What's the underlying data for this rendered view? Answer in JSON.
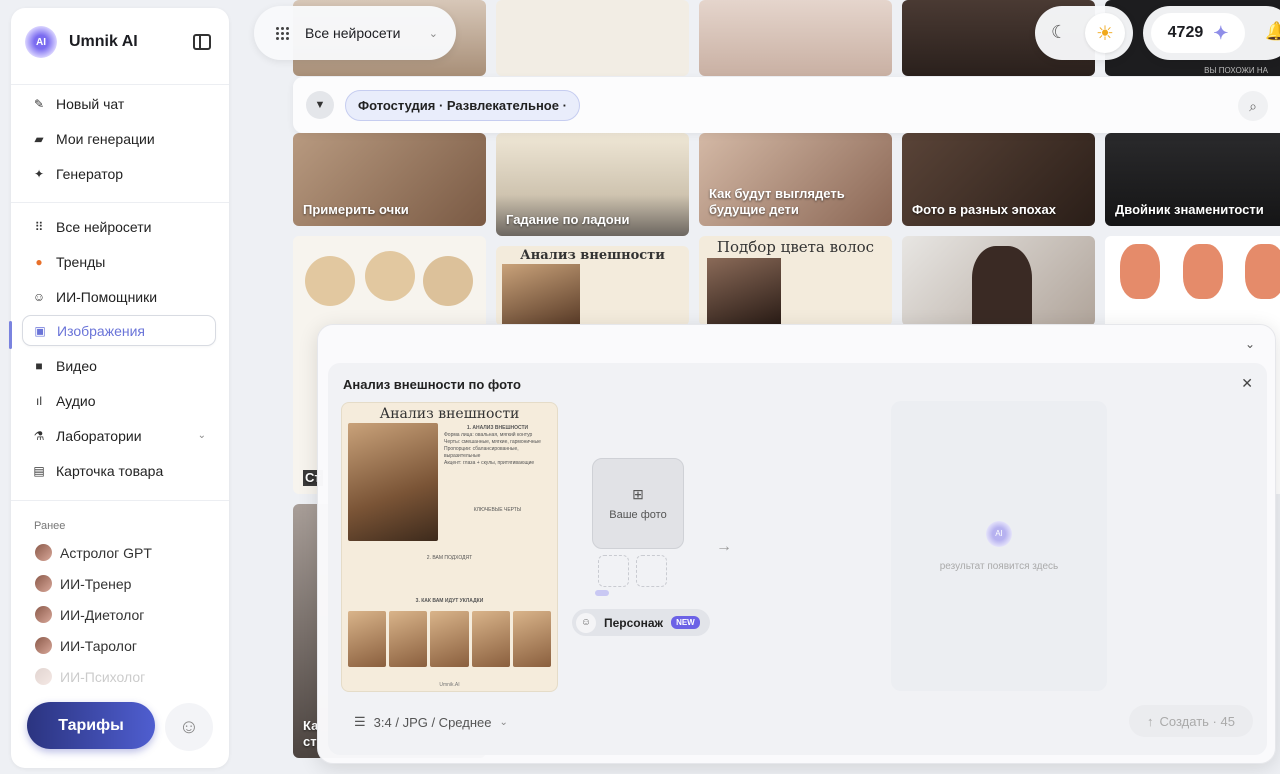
{
  "brand": {
    "name": "Umnik AI",
    "logo_text": "AI"
  },
  "nav_primary": [
    {
      "icon": "pen-icon",
      "label": "Новый чат"
    },
    {
      "icon": "folder-icon",
      "label": "Мои генерации"
    },
    {
      "icon": "sparkle-icon",
      "label": "Генератор"
    }
  ],
  "nav_secondary": [
    {
      "icon": "grid-icon",
      "label": "Все нейросети"
    },
    {
      "icon": "fire-icon",
      "label": "Тренды"
    },
    {
      "icon": "robot-icon",
      "label": "ИИ-Помощники"
    },
    {
      "icon": "image-icon",
      "label": "Изображения",
      "active": true
    },
    {
      "icon": "video-icon",
      "label": "Видео"
    },
    {
      "icon": "audio-icon",
      "label": "Аудио"
    },
    {
      "icon": "flask-icon",
      "label": "Лаборатории"
    },
    {
      "icon": "card-icon",
      "label": "Карточка товара"
    }
  ],
  "recent": {
    "heading": "Ранее",
    "items": [
      "Астролог GPT",
      "ИИ-Тренер",
      "ИИ-Диетолог",
      "ИИ-Таролог",
      "ИИ-Психолог"
    ]
  },
  "footer": {
    "tariffs_label": "Тарифы"
  },
  "topbar": {
    "model_select": "Все нейросети",
    "credits": "4729"
  },
  "filter": {
    "chip": "Фотостудия · Развлекательное ·"
  },
  "cards": [
    "Примерить очки",
    "Гадание по ладони",
    "Как будут выглядеть будущие дети",
    "Фото в разных эпохах",
    "Двойник знаменитости",
    "Анализ внешности",
    "Подбор цвета волос",
    "ВЫ ПОХОЖИ НА",
    "Ст",
    "Ка ст"
  ],
  "panel": {
    "title": "Анализ внешности по фото",
    "upload_label": "Ваше фото",
    "persona_label": "Персонаж",
    "new_badge": "NEW",
    "result_placeholder": "результат появится здесь",
    "settings": "3:4 / JPG / Среднее",
    "create_label": "Создать · 45"
  },
  "preview": {
    "title": "Анализ внешности",
    "section1": "1. АНАЛИЗ ВНЕШНОСТИ",
    "section2": "2. ВАМ ПОДХОДЯТ",
    "section3": "3. КАК ВАМ ИДУТ УКЛАДКИ",
    "key": "КЛЮЧЕВЫЕ ЧЕРТЫ",
    "footer": "Umnik.AI",
    "lines": [
      "Форма лица: овальная, мягкий контур",
      "Черты: смешанные, мягкие, гармоничные",
      "Пропорции: сбалансированные, выразительные",
      "Акцент: глаза + скулы, притягивающие"
    ]
  }
}
